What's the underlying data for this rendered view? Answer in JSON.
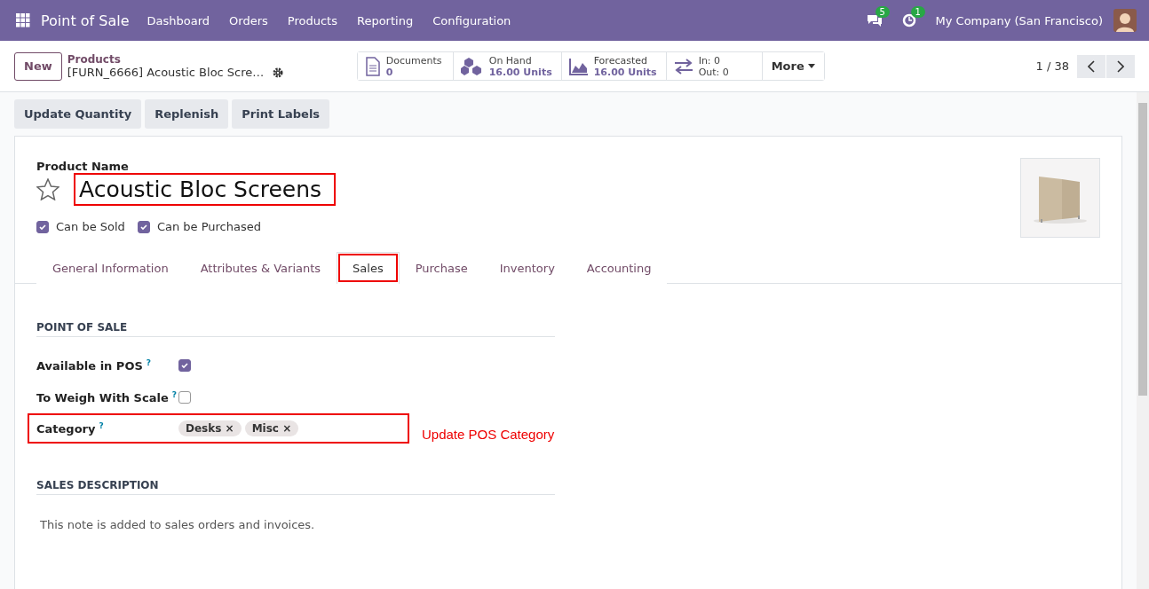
{
  "navbar": {
    "app_title": "Point of Sale",
    "menu": [
      "Dashboard",
      "Orders",
      "Products",
      "Reporting",
      "Configuration"
    ],
    "messages_badge": "5",
    "activities_badge": "1",
    "company": "My Company (San Francisco)"
  },
  "control_panel": {
    "new_button": "New",
    "breadcrumb": {
      "parent": "Products",
      "current": "[FURN_6666] Acoustic Bloc Scre…"
    },
    "smart_buttons": [
      {
        "kind": "documents",
        "label": "Documents",
        "value": "0"
      },
      {
        "kind": "onhand",
        "label": "On Hand",
        "value": "16.00 Units"
      },
      {
        "kind": "forecast",
        "label": "Forecasted",
        "value": "16.00 Units"
      },
      {
        "kind": "inout",
        "label": "In: 0",
        "value": "Out: 0"
      }
    ],
    "more": "More",
    "pager": "1 / 38"
  },
  "actions": [
    "Update Quantity",
    "Replenish",
    "Print Labels"
  ],
  "form": {
    "name_label": "Product Name",
    "name": "Acoustic Bloc Screens",
    "name_highlighted": true,
    "favorite": false,
    "options": [
      {
        "label": "Can be Sold",
        "checked": true
      },
      {
        "label": "Can be Purchased",
        "checked": true
      }
    ],
    "tabs": [
      {
        "label": "General Information",
        "selected": false,
        "highlighted": false
      },
      {
        "label": "Attributes & Variants",
        "selected": false,
        "highlighted": false
      },
      {
        "label": "Sales",
        "selected": true,
        "highlighted": true
      },
      {
        "label": "Purchase",
        "selected": false,
        "highlighted": false
      },
      {
        "label": "Inventory",
        "selected": false,
        "highlighted": false
      },
      {
        "label": "Accounting",
        "selected": false,
        "highlighted": false
      }
    ],
    "point_of_sale": {
      "title": "POINT OF SALE",
      "fields": [
        {
          "kind": "checkbox",
          "label": "Available in POS",
          "help": "?",
          "checked": true
        },
        {
          "kind": "checkbox",
          "label": "To Weigh With Scale",
          "help": "?",
          "checked": false
        },
        {
          "kind": "tags",
          "label": "Category",
          "help": "?",
          "highlighted": true,
          "note": "Update POS Category",
          "tags": [
            {
              "label": "Desks",
              "remove": "×"
            },
            {
              "label": "Misc",
              "remove": "×"
            }
          ]
        }
      ]
    },
    "sales_description": {
      "title": "SALES DESCRIPTION",
      "placeholder": "This note is added to sales orders and invoices."
    }
  }
}
